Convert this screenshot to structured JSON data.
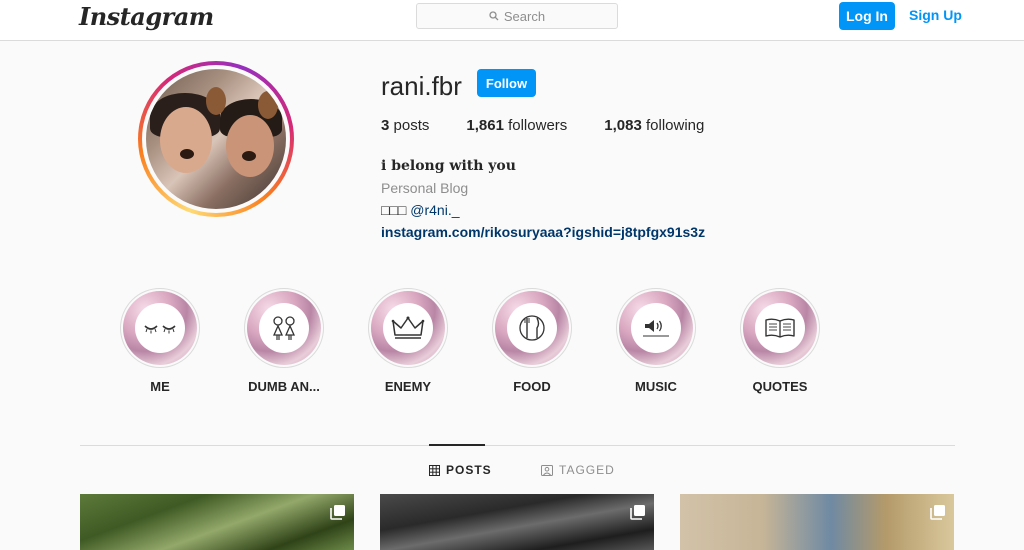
{
  "nav": {
    "logo": "Instagram",
    "search_placeholder": "Search",
    "login_label": "Log In",
    "signup_label": "Sign Up"
  },
  "profile": {
    "username": "rani.fbr",
    "follow_label": "Follow",
    "stats": {
      "posts_count": "3",
      "posts_label": "posts",
      "followers_count": "1,861",
      "followers_label": "followers",
      "following_count": "1,083",
      "following_label": "following"
    },
    "bio": {
      "name": "i belong with you",
      "category": "Personal Blog",
      "line_prefix": "□□□",
      "mention": "@r4ni._",
      "link": "instagram.com/rikosuryaaa?igshid=j8tpfgx91s3z"
    }
  },
  "highlights": [
    {
      "label": "ME",
      "icon": "closed-eyes-icon"
    },
    {
      "label": "DUMB AN...",
      "icon": "two-girls-icon"
    },
    {
      "label": "ENEMY",
      "icon": "crown-icon"
    },
    {
      "label": "FOOD",
      "icon": "fork-knife-icon"
    },
    {
      "label": "MUSIC",
      "icon": "speaker-icon"
    },
    {
      "label": "QUOTES",
      "icon": "open-book-icon"
    }
  ],
  "tabs": {
    "posts_label": "POSTS",
    "tagged_label": "TAGGED",
    "active": "POSTS"
  },
  "colors": {
    "accent": "#0095f6",
    "link": "#00376b",
    "text": "#262626",
    "muted": "#8e8e8e",
    "border": "#dbdbdb"
  }
}
